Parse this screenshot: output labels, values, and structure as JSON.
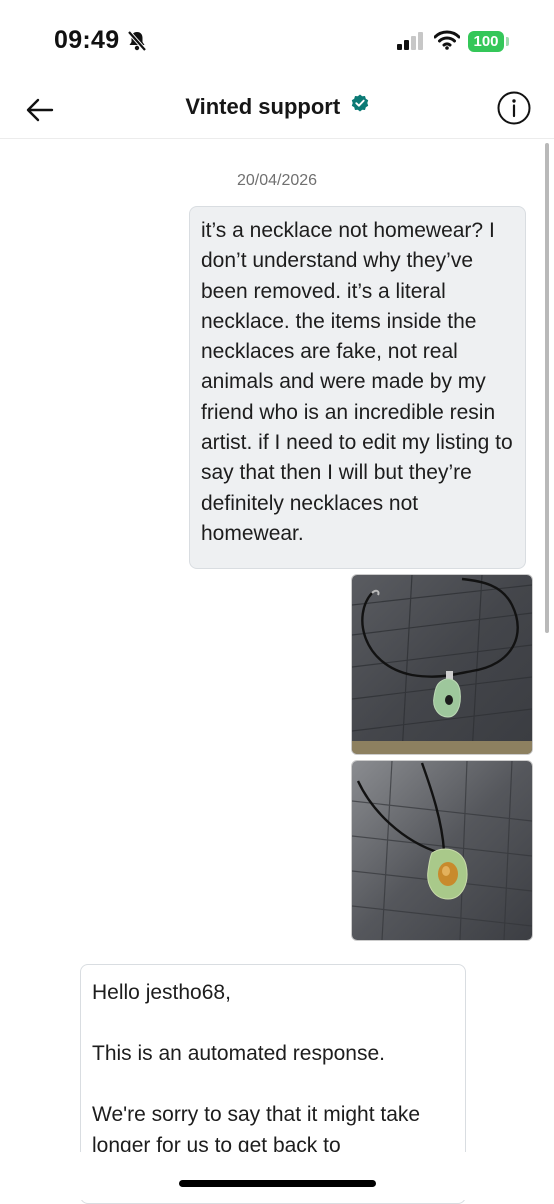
{
  "status_bar": {
    "time": "09:49",
    "battery": "100",
    "battery_color": "#34c759"
  },
  "header": {
    "title": "Vinted support",
    "back_icon": "arrow-left-icon",
    "verified_icon": "verified-badge-icon",
    "verified_color": "#0b7a75",
    "info_icon": "info-circle-icon"
  },
  "conversation": {
    "date": "20/04/2026",
    "outgoing_message": "it’s a necklace not homewear? I don’t understand why they’ve been removed. it’s a literal necklace. the items inside the necklaces are fake, not real animals and were made by my friend who is an incredible resin artist. if I need to edit my listing to say that then I will but they’re definitely necklaces not homewear.",
    "attachments": [
      {
        "type": "photo",
        "description_icon": "necklace-photo-icon"
      },
      {
        "type": "photo",
        "description_icon": "necklace-photo-icon"
      }
    ],
    "incoming_message": {
      "greeting": "Hello jestho68,",
      "line1": "This is an automated response.",
      "line2": "We're sorry to say that it might take longer for us to get back to"
    }
  }
}
